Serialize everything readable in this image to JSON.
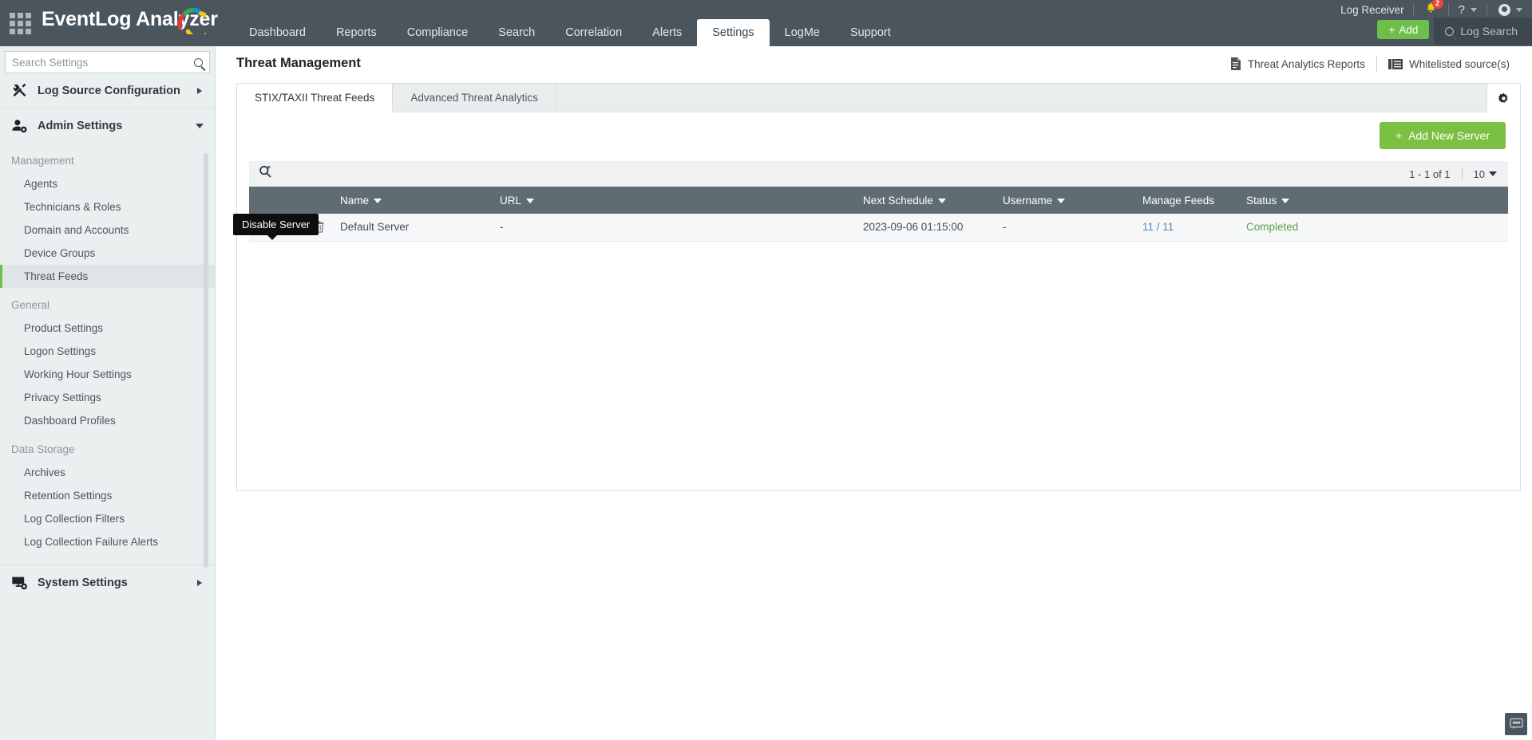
{
  "app": {
    "brand": "EventLog Analyzer",
    "grid_icon": "apps-grid-icon"
  },
  "header": {
    "nav": [
      {
        "label": "Dashboard",
        "active": false
      },
      {
        "label": "Reports",
        "active": false
      },
      {
        "label": "Compliance",
        "active": false
      },
      {
        "label": "Search",
        "active": false
      },
      {
        "label": "Correlation",
        "active": false
      },
      {
        "label": "Alerts",
        "active": false
      },
      {
        "label": "Settings",
        "active": true
      },
      {
        "label": "LogMe",
        "active": false
      },
      {
        "label": "Support",
        "active": false
      }
    ],
    "log_receiver": "Log Receiver",
    "notification_count": "2",
    "help_label": "?",
    "add_button": "Add",
    "add_plus": "+",
    "log_search": "Log Search"
  },
  "sidebar": {
    "search_placeholder": "Search Settings",
    "search_value": "",
    "groups": [
      {
        "label": "Log Source Configuration",
        "icon": "tools-icon",
        "expanded": false
      },
      {
        "label": "Admin Settings",
        "icon": "user-gear-icon",
        "expanded": true
      },
      {
        "label": "System Settings",
        "icon": "monitor-gear-icon",
        "expanded": false
      }
    ],
    "sections": [
      {
        "title": "Management",
        "items": [
          {
            "label": "Agents",
            "active": false
          },
          {
            "label": "Technicians & Roles",
            "active": false
          },
          {
            "label": "Domain and Accounts",
            "active": false
          },
          {
            "label": "Device Groups",
            "active": false
          },
          {
            "label": "Threat Feeds",
            "active": true
          }
        ]
      },
      {
        "title": "General",
        "items": [
          {
            "label": "Product Settings",
            "active": false
          },
          {
            "label": "Logon Settings",
            "active": false
          },
          {
            "label": "Working Hour Settings",
            "active": false
          },
          {
            "label": "Privacy Settings",
            "active": false
          },
          {
            "label": "Dashboard Profiles",
            "active": false
          }
        ]
      },
      {
        "title": "Data Storage",
        "items": [
          {
            "label": "Archives",
            "active": false
          },
          {
            "label": "Retention Settings",
            "active": false
          },
          {
            "label": "Log Collection Filters",
            "active": false
          },
          {
            "label": "Log Collection Failure Alerts",
            "active": false
          }
        ]
      }
    ]
  },
  "main": {
    "page_title": "Threat Management",
    "actions": [
      {
        "label": "Threat Analytics Reports",
        "icon": "report-doc-icon"
      },
      {
        "label": "Whitelisted source(s)",
        "icon": "whitelist-icon"
      }
    ],
    "tabs": [
      {
        "label": "STIX/TAXII Threat Feeds",
        "active": true
      },
      {
        "label": "Advanced Threat Analytics",
        "active": false
      }
    ],
    "settings_gear_icon": "gear-icon",
    "add_new_server": {
      "label": "Add New Server",
      "plus": "+"
    },
    "toolbar": {
      "search_icon": "search-icon",
      "range_text": "1 - 1 of 1",
      "page_size": "10"
    },
    "table": {
      "columns": [
        {
          "label": "",
          "sortable": false
        },
        {
          "label": "Name",
          "sortable": true
        },
        {
          "label": "URL",
          "sortable": true
        },
        {
          "label": "Next Schedule",
          "sortable": true
        },
        {
          "label": "Username",
          "sortable": true
        },
        {
          "label": "Manage Feeds",
          "sortable": false
        },
        {
          "label": "Status",
          "sortable": true
        }
      ],
      "rows": [
        {
          "name": "Default Server",
          "url": "-",
          "next_schedule": "2023-09-06 01:15:00",
          "username": "-",
          "manage_feeds": "11 / 11",
          "status": "Completed",
          "actions": [
            "enable-toggle-icon",
            "edit-icon",
            "delete-icon"
          ]
        }
      ]
    },
    "tooltip": "Disable Server"
  },
  "footer": {
    "chat_icon": "chat-bubble-icon"
  },
  "colors": {
    "header_bg": "#4a555e",
    "accent_green": "#6cc04a",
    "table_header": "#5f6c74",
    "link_blue": "#5b87b5",
    "status_green": "#5aa148",
    "badge_red": "#e8453c"
  }
}
